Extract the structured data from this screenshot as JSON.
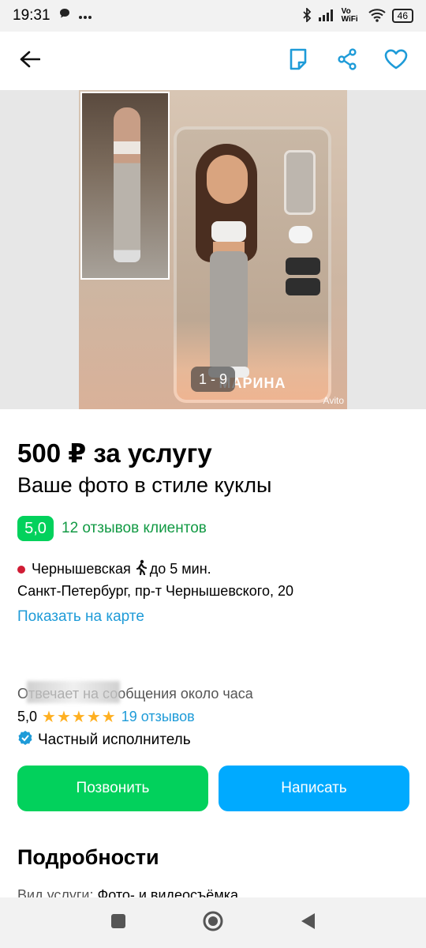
{
  "status_bar": {
    "time": "19:31",
    "icons": [
      "chat-bubble-icon",
      "more-dots-icon",
      "bluetooth-icon",
      "signal-icon",
      "vowifi-icon",
      "wifi-icon"
    ],
    "vowifi_text": "Vo WiFi",
    "battery": "46"
  },
  "appbar": {
    "back_icon": "arrow-left-icon",
    "note_icon": "note-icon",
    "share_icon": "share-icon",
    "favorite_icon": "heart-icon"
  },
  "gallery": {
    "counter": "1 - 9",
    "box_name": "МАРИНА",
    "watermark": "Avito"
  },
  "listing": {
    "price": "500 ₽ за услугу",
    "title": "Ваше фото в стиле куклы",
    "rating": "5,0",
    "reviews_link": "12 отзывов клиентов",
    "metro": "Чернышевская",
    "walk_time": "до 5 мин.",
    "address": "Санкт-Петербург, пр-т Чернышевского, 20",
    "map_link": "Показать на карте"
  },
  "seller": {
    "response_time": "Отвечает на сообщения около часа",
    "rating": "5,0",
    "stars": "★★★★★",
    "reviews": "19 отзывов",
    "type": "Частный исполнитель"
  },
  "actions": {
    "call": "Позвонить",
    "write": "Написать"
  },
  "details": {
    "title": "Подробности",
    "service_label": "Вид услуги:",
    "service_value": "Фото- и видеосъёмка"
  },
  "colors": {
    "green": "#02d15c",
    "blue": "#00aaff",
    "link_blue": "#1e9bd8",
    "metro_red": "#d01c34",
    "star": "#ffb021"
  }
}
